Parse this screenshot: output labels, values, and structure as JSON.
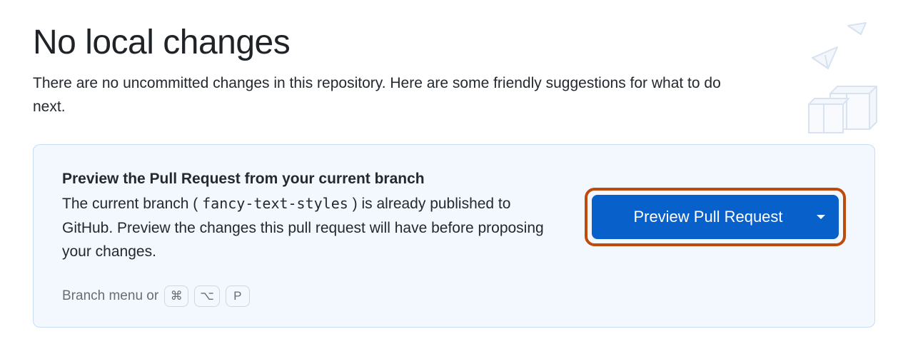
{
  "header": {
    "title": "No local changes",
    "subtitle": "There are no uncommitted changes in this repository. Here are some friendly suggestions for what to do next."
  },
  "suggestion": {
    "title": "Preview the Pull Request from your current branch",
    "desc_prefix": "The current branch (",
    "branch_name": "fancy-text-styles",
    "desc_suffix": ") is already published to GitHub. Preview the changes this pull request will have before proposing your changes.",
    "button_label": "Preview Pull Request"
  },
  "shortcut": {
    "prefix": "Branch menu or",
    "keys": [
      "⌘",
      "⌥",
      "P"
    ]
  }
}
